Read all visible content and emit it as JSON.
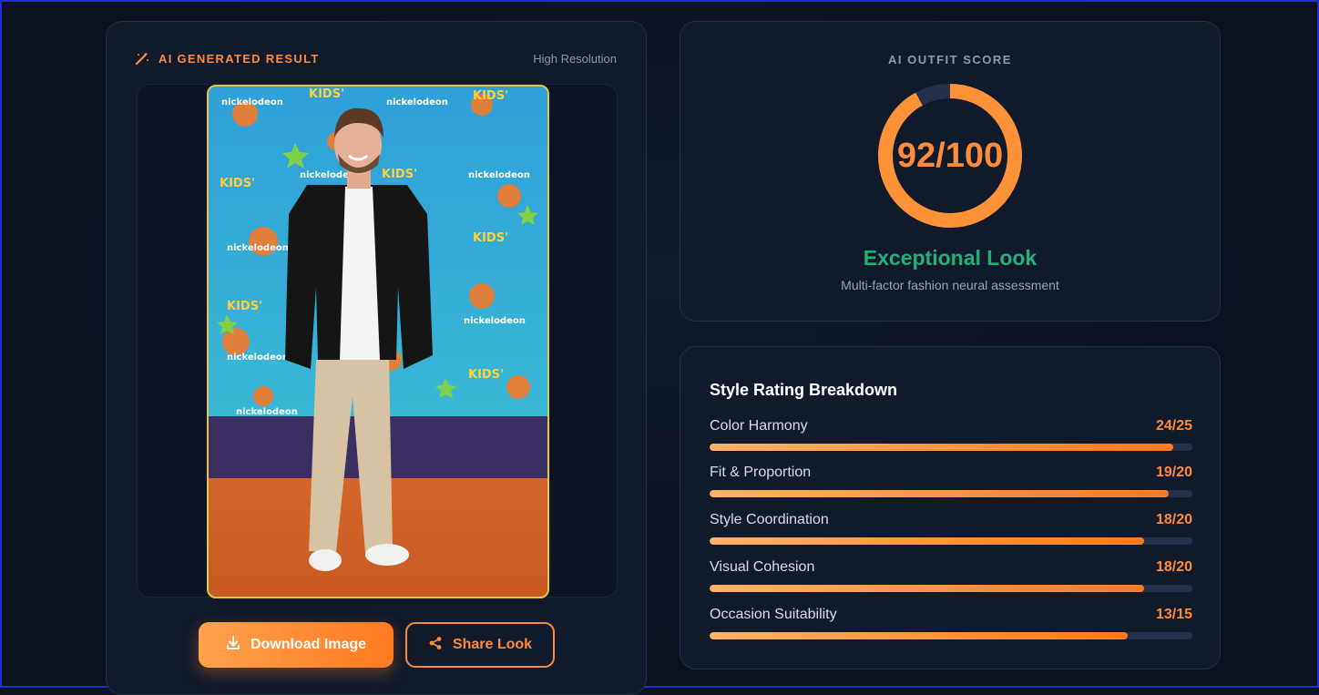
{
  "result_panel": {
    "title": "AI GENERATED RESULT",
    "badge": "High Resolution",
    "image_alt": "Outfit photo",
    "download_label": "Download Image",
    "share_label": "Share Look"
  },
  "score_panel": {
    "label": "AI OUTFIT SCORE",
    "score": 92,
    "max": 100,
    "score_text": "92/100",
    "verdict": "Exceptional Look",
    "subtitle": "Multi-factor fashion neural assessment"
  },
  "breakdown": {
    "title": "Style Rating Breakdown",
    "metrics": [
      {
        "name": "Color Harmony",
        "score_text": "24/25",
        "score": 24,
        "max": 25
      },
      {
        "name": "Fit & Proportion",
        "score_text": "19/20",
        "score": 19,
        "max": 20
      },
      {
        "name": "Style Coordination",
        "score_text": "18/20",
        "score": 18,
        "max": 20
      },
      {
        "name": "Visual Cohesion",
        "score_text": "18/20",
        "score": 18,
        "max": 20
      },
      {
        "name": "Occasion Suitability",
        "score_text": "13/15",
        "score": 13,
        "max": 15
      }
    ]
  },
  "colors": {
    "accent": "#ff8c3a",
    "success": "#20b07a",
    "background": "#0d1321",
    "card": "#111a2a"
  },
  "icons": {
    "title_icon": "magic-wand-icon",
    "download_icon": "download-icon",
    "share_icon": "share-icon"
  }
}
